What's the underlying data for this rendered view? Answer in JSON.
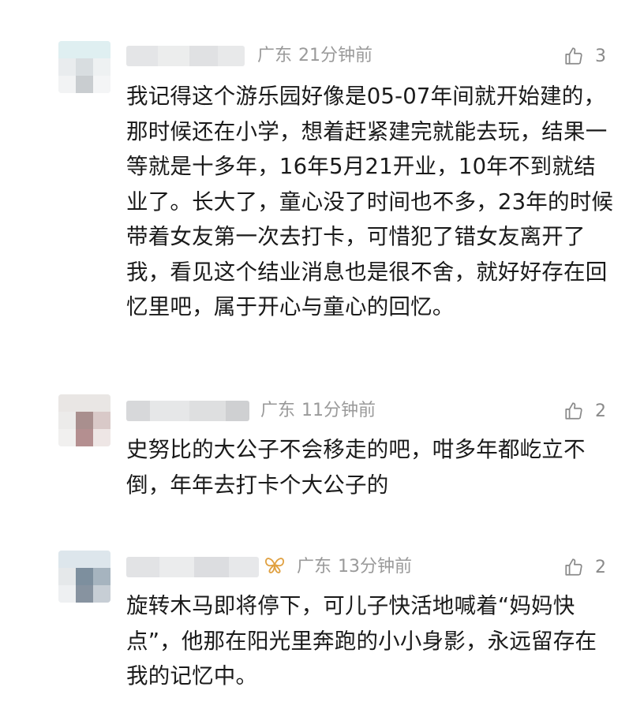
{
  "comments": [
    {
      "location": "广东",
      "time": "21分钟前",
      "likes": "3",
      "text": "我记得这个游乐园好像是05-07年间就开始建的，那时候还在小学，想着赶紧建完就能去玩，结果一等就是十多年，16年5月21开业，10年不到就结业了。长大了，童心没了时间也不多，23年的时候带着女友第一次去打卡，可惜犯了错女友离开了我，看见这个结业消息也是很不舍，就好好存在回忆里吧，属于开心与童心的回忆。"
    },
    {
      "location": "广东",
      "time": "11分钟前",
      "likes": "2",
      "text": "史努比的大公子不会移走的吧，咁多年都屹立不倒，年年去打卡个大公子的"
    },
    {
      "location": "广东",
      "time": "13分钟前",
      "likes": "2",
      "text": "旋转木马即将停下，可儿子快活地喊着“妈妈快点”，他那在阳光里奔跑的小小身影，永远留存在我的记忆中。"
    }
  ],
  "colors": {
    "meta": "#9a9a9a",
    "text": "#1a1a1a",
    "badge": "#e0a040"
  }
}
